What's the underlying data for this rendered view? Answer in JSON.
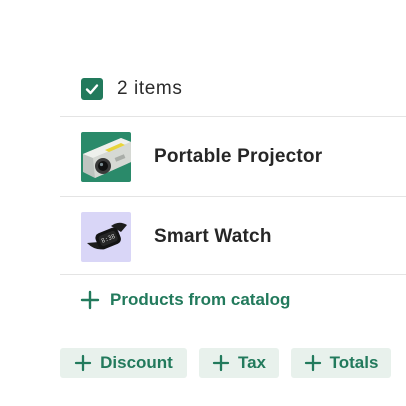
{
  "selection": {
    "label": "2 items",
    "checked": true
  },
  "items": [
    {
      "name": "Portable Projector",
      "thumbnail": "projector-image",
      "thumb_bg": "#2a8a6a"
    },
    {
      "name": "Smart Watch",
      "thumbnail": "smartwatch-image",
      "thumb_bg": "#d9d6f7"
    }
  ],
  "actions": {
    "catalog_label": "Products from catalog",
    "discount_label": "Discount",
    "tax_label": "Tax",
    "totals_label": "Totals",
    "icon": "plus-icon"
  },
  "colors": {
    "accent": "#227a5c",
    "pill_background": "#e8f1ec",
    "divider": "#e4e4e4"
  }
}
